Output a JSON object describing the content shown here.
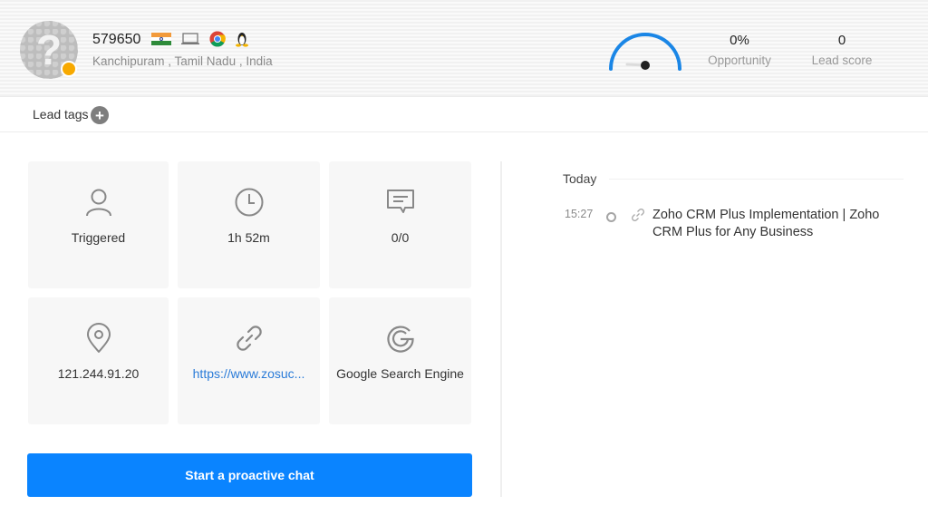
{
  "visitor": {
    "id": "579650",
    "location": "Kanchipuram , Tamil Nadu , India",
    "country_flag": "india-flag",
    "device_icon": "laptop-icon",
    "browser_icon": "chrome-icon",
    "os_icon": "linux-icon",
    "status_color": "#f7a900"
  },
  "stats": {
    "opportunity_value": "0%",
    "opportunity_label": "Opportunity",
    "lead_score_value": "0",
    "lead_score_label": "Lead score",
    "gauge_level_percent": 0
  },
  "tags": {
    "label": "Lead tags",
    "add_symbol": "+"
  },
  "cards": [
    {
      "icon": "user-icon",
      "text": "Triggered"
    },
    {
      "icon": "clock-icon",
      "text": "1h 52m"
    },
    {
      "icon": "chat-icon",
      "text": "0/0"
    },
    {
      "icon": "location-pin-icon",
      "text": "121.244.91.20"
    },
    {
      "icon": "link-icon",
      "text": "https://www.zosuc..."
    },
    {
      "icon": "google-icon",
      "text": "Google Search Engine"
    }
  ],
  "cta": {
    "label": "Start a proactive chat",
    "color": "#0a84ff"
  },
  "timeline": {
    "group_label": "Today",
    "entries": [
      {
        "time": "15:27",
        "icon": "link-icon",
        "title": "Zoho CRM Plus Implementation | Zoho CRM Plus for Any Business"
      }
    ]
  }
}
